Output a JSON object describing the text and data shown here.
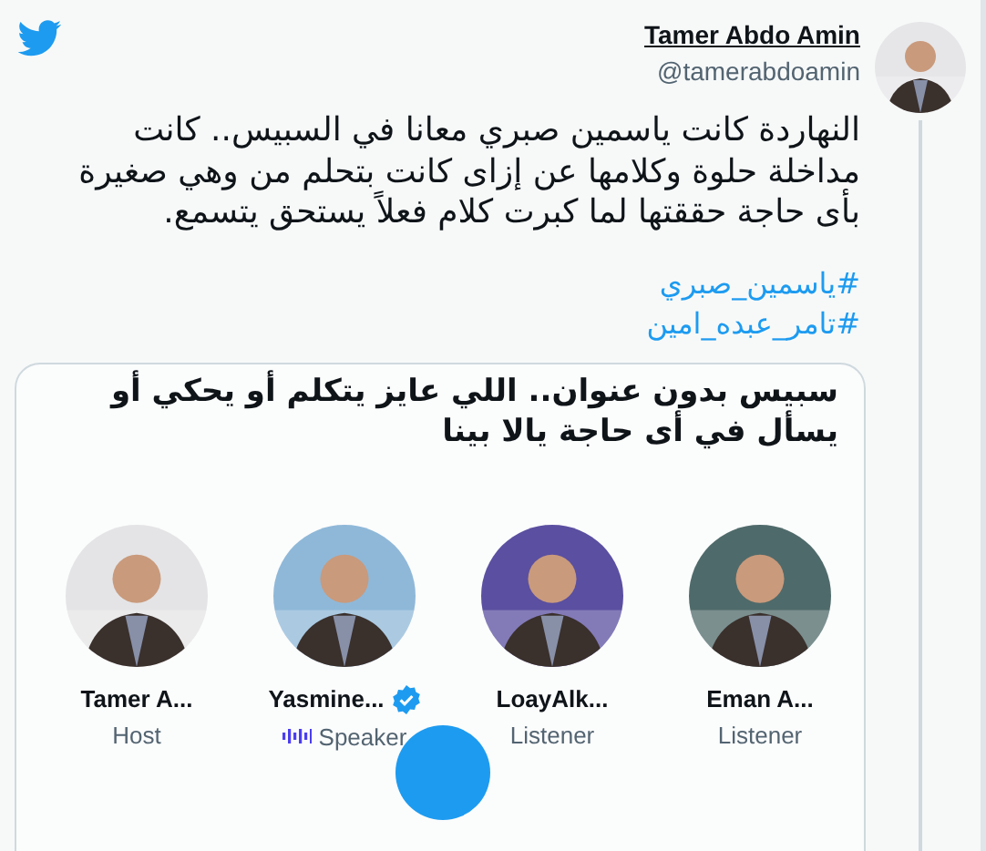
{
  "author": {
    "name": "Tamer Abdo Amin",
    "handle": "@tamerabdoamin"
  },
  "tweet": {
    "text": "النهاردة كانت ياسمين صبري معانا في السبيس.. كانت مداخلة حلوة وكلامها عن إزاى كانت بتحلم من وهي صغيرة بأى حاجة حققتها لما كبرت كلام فعلاً يستحق يتسمع.",
    "hashtags": [
      "#ياسمين_صبري",
      "#تامر_عبده_امين"
    ]
  },
  "space": {
    "title": "سبيس بدون عنوان.. اللي عايز يتكلم أو يحكي أو يسأل في أى حاجة يالا بينا",
    "participants": [
      {
        "name": "Eman A...",
        "role": "Listener",
        "verified": false,
        "speaking": false,
        "color": "#4f6a6a"
      },
      {
        "name": "LoayAlk...",
        "role": "Listener",
        "verified": false,
        "speaking": false,
        "color": "#5a4fa0"
      },
      {
        "name": "Yasmine...",
        "role": "Speaker",
        "verified": true,
        "speaking": true,
        "color": "#8fb8d8"
      },
      {
        "name": "Tamer A...",
        "role": "Host",
        "verified": false,
        "speaking": false,
        "color": "#e4e4e6"
      }
    ]
  }
}
